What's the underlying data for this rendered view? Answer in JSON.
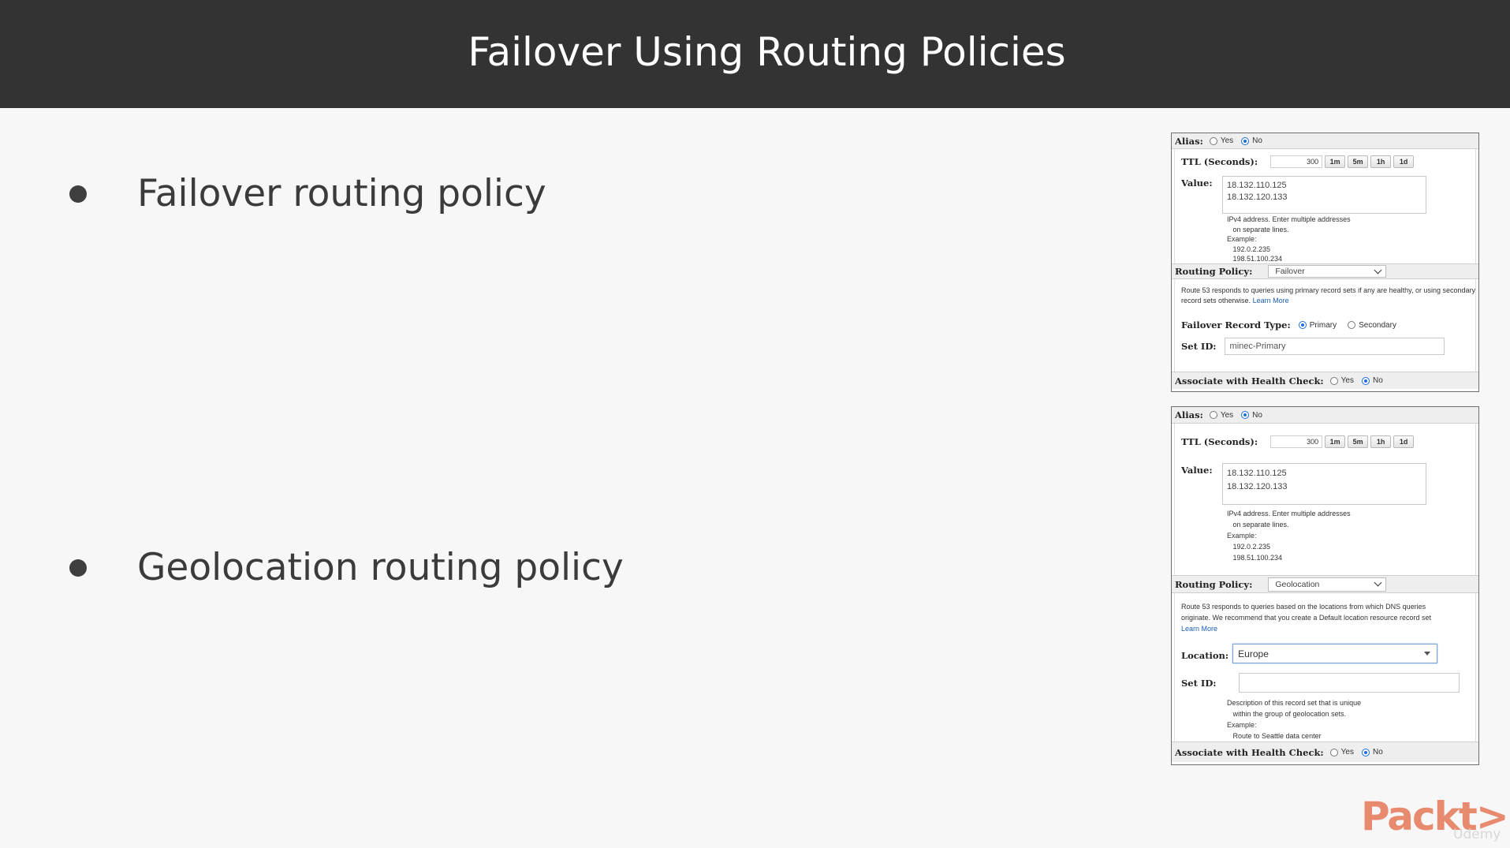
{
  "slide": {
    "title": "Failover Using Routing Policies",
    "bullets": [
      "Failover routing policy",
      "Geolocation routing policy"
    ]
  },
  "panel1": {
    "alias_label": "Alias:",
    "alias_yes": "Yes",
    "alias_no": "No",
    "alias_selected": "No",
    "ttl_label": "TTL (Seconds):",
    "ttl_value": "300",
    "ttl_buttons": [
      "1m",
      "5m",
      "1h",
      "1d"
    ],
    "value_label": "Value:",
    "value_lines": [
      "18.132.110.125",
      "18.132.120.133"
    ],
    "value_help": "IPv4 address. Enter multiple addresses\n   on separate lines.\nExample:\n   192.0.2.235\n   198.51.100.234",
    "routing_label": "Routing Policy:",
    "routing_value": "Failover",
    "routing_desc": "Route 53 responds to queries using primary record sets if any are healthy, or using secondary record sets otherwise.",
    "learn_more": "Learn More",
    "failover_type_label": "Failover Record Type:",
    "failover_primary": "Primary",
    "failover_secondary": "Secondary",
    "failover_selected": "Primary",
    "set_id_label": "Set ID:",
    "set_id_value": "minec-Primary",
    "health_label": "Associate with Health Check:",
    "health_yes": "Yes",
    "health_no": "No",
    "health_selected": "No"
  },
  "panel2": {
    "alias_label": "Alias:",
    "alias_yes": "Yes",
    "alias_no": "No",
    "alias_selected": "No",
    "ttl_label": "TTL (Seconds):",
    "ttl_value": "300",
    "ttl_buttons": [
      "1m",
      "5m",
      "1h",
      "1d"
    ],
    "value_label": "Value:",
    "value_lines": [
      "18.132.110.125",
      "18.132.120.133"
    ],
    "value_help": "IPv4 address. Enter multiple addresses\n   on separate lines.\nExample:\n   192.0.2.235\n   198.51.100.234",
    "routing_label": "Routing Policy:",
    "routing_value": "Geolocation",
    "routing_desc": "Route 53 responds to queries based on the locations from which DNS queries originate. We recommend that you create a Default location resource record set",
    "learn_more": "Learn More",
    "location_label": "Location:",
    "location_value": "Europe",
    "set_id_label": "Set ID:",
    "set_id_value": "",
    "set_id_help": "Description of this record set that is unique\n   within the group of geolocation sets.\nExample:\n   Route to Seattle data center",
    "health_label": "Associate with Health Check:",
    "health_yes": "Yes",
    "health_no": "No",
    "health_selected": "No"
  },
  "brand": {
    "logo": "Packt>",
    "sub": "Udemy",
    "logo_color": "#e88a6e"
  }
}
